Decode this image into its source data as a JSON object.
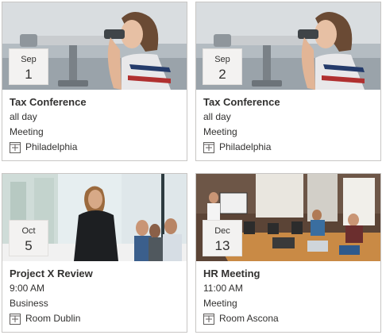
{
  "events": [
    {
      "month": "Sep",
      "day": "1",
      "title": "Tax Conference",
      "time": "all day",
      "category": "Meeting",
      "location": "Philadelphia",
      "location_icon": "location-building-icon",
      "image": "woman-at-binoculars-photo"
    },
    {
      "month": "Sep",
      "day": "2",
      "title": "Tax Conference",
      "time": "all day",
      "category": "Meeting",
      "location": "Philadelphia",
      "location_icon": "location-building-icon",
      "image": "woman-at-binoculars-photo"
    },
    {
      "month": "Oct",
      "day": "5",
      "title": "Project X Review",
      "time": "9:00 AM",
      "category": "Business",
      "location": "Room Dublin",
      "location_icon": "location-building-icon",
      "image": "office-presentation-photo"
    },
    {
      "month": "Dec",
      "day": "13",
      "title": "HR Meeting",
      "time": "11:00 AM",
      "category": "Meeting",
      "location": "Room Ascona",
      "location_icon": "location-building-icon",
      "image": "conference-room-photo"
    }
  ]
}
